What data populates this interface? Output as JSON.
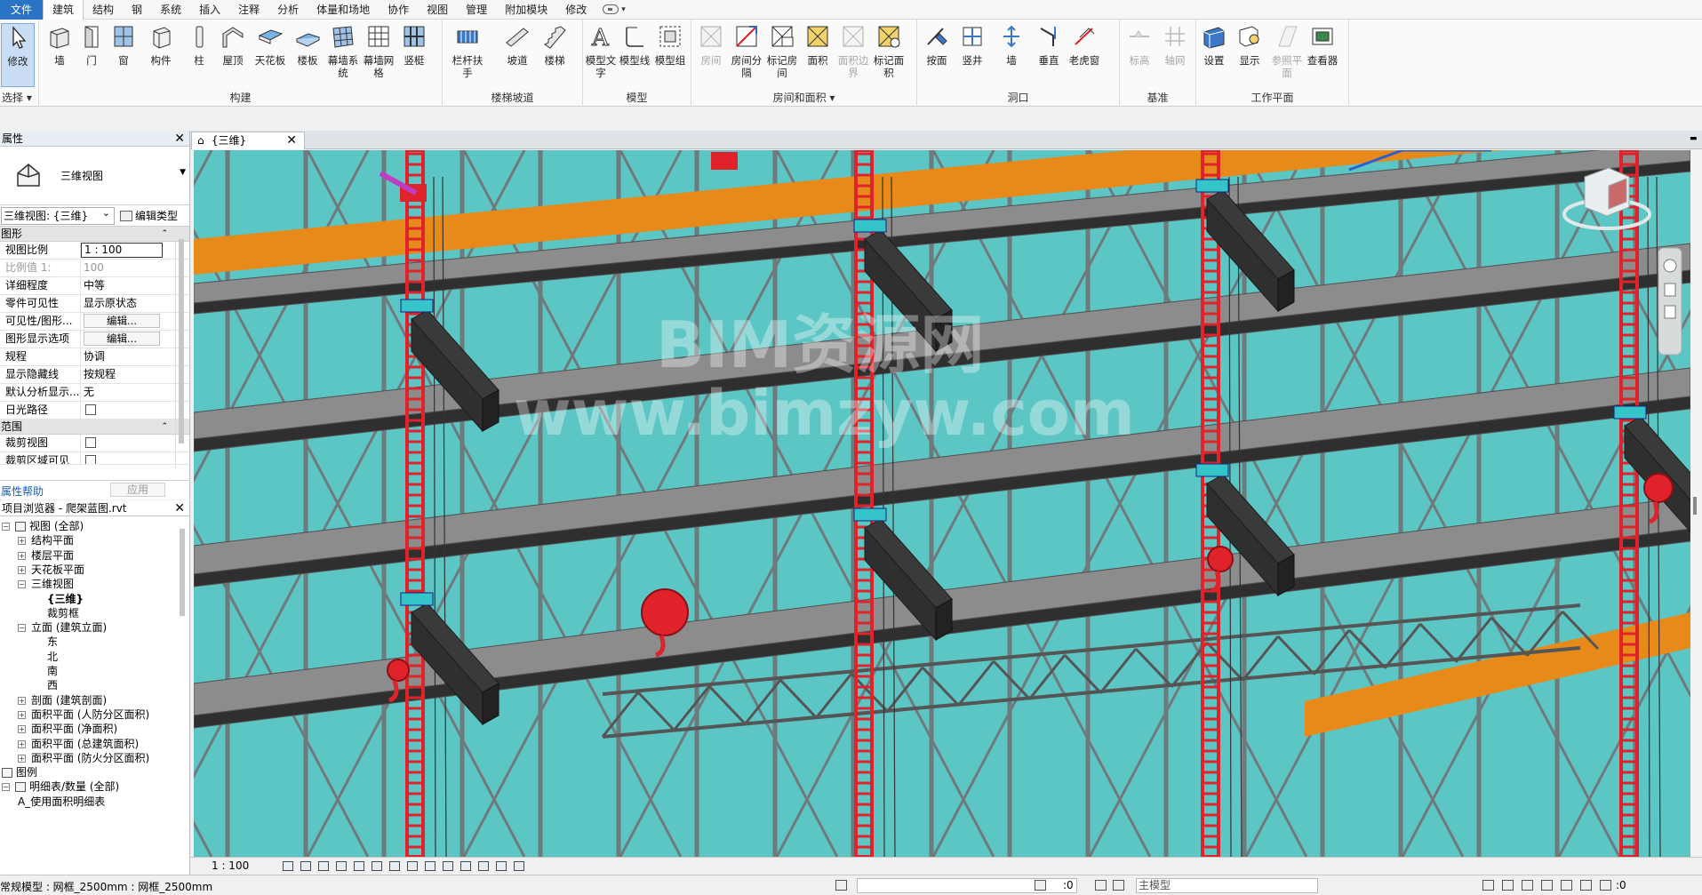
{
  "menu": {
    "file": "文件",
    "tabs": [
      "建筑",
      "结构",
      "钢",
      "系统",
      "插入",
      "注释",
      "分析",
      "体量和场地",
      "协作",
      "视图",
      "管理",
      "附加模块",
      "修改"
    ],
    "active_tab": "建筑"
  },
  "ribbon": {
    "select": {
      "modify": "修改",
      "label": "选择 ▾"
    },
    "build": {
      "label": "构建",
      "buttons": [
        "墙",
        "门",
        "窗",
        "构件",
        "柱",
        "屋顶",
        "天花板",
        "楼板",
        "幕墙系统",
        "幕墙网格",
        "竖梃"
      ]
    },
    "circulation": {
      "label": "楼梯坡道",
      "buttons": [
        "栏杆扶手",
        "坡道",
        "楼梯"
      ]
    },
    "model": {
      "label": "模型",
      "buttons": [
        "模型文字",
        "模型线",
        "模型组"
      ]
    },
    "room": {
      "label": "房间和面积 ▾",
      "buttons": [
        "房间",
        "房间分隔",
        "标记房间",
        "面积",
        "面积边界",
        "标记面积"
      ]
    },
    "opening": {
      "label": "洞口",
      "buttons": [
        "按面",
        "竖井",
        "墙",
        "垂直",
        "老虎窗"
      ]
    },
    "datum": {
      "label": "基准",
      "buttons": [
        "标高",
        "轴网"
      ]
    },
    "workplane": {
      "label": "工作平面",
      "buttons": [
        "设置",
        "显示",
        "参照平面",
        "查看器"
      ]
    }
  },
  "properties": {
    "title": "属性",
    "type_name": "三维视图",
    "selector": "三维视图: {三维}",
    "edit_type": "编辑类型",
    "sections": {
      "graphics": "图形",
      "extents": "范围"
    },
    "rows": [
      {
        "k": "视图比例",
        "v": "1 : 100"
      },
      {
        "k": "比例值 1:",
        "v": "100"
      },
      {
        "k": "详细程度",
        "v": "中等"
      },
      {
        "k": "零件可见性",
        "v": "显示原状态"
      },
      {
        "k": "可见性/图形...",
        "v": "编辑..."
      },
      {
        "k": "图形显示选项",
        "v": "编辑..."
      },
      {
        "k": "规程",
        "v": "协调"
      },
      {
        "k": "显示隐藏线",
        "v": "按规程"
      },
      {
        "k": "默认分析显示...",
        "v": "无"
      },
      {
        "k": "日光路径",
        "v": ""
      }
    ],
    "extent_rows": [
      {
        "k": "裁剪视图",
        "v": ""
      },
      {
        "k": "裁剪区域可见",
        "v": ""
      }
    ],
    "help": "属性帮助",
    "apply": "应用"
  },
  "browser": {
    "title": "项目浏览器 - 爬架蓝图.rvt",
    "nodes": [
      {
        "t": "视图 (全部)",
        "lvl": 0,
        "ex": "−"
      },
      {
        "t": "结构平面",
        "lvl": 1,
        "ex": "+"
      },
      {
        "t": "楼层平面",
        "lvl": 1,
        "ex": "+"
      },
      {
        "t": "天花板平面",
        "lvl": 1,
        "ex": "+"
      },
      {
        "t": "三维视图",
        "lvl": 1,
        "ex": "−"
      },
      {
        "t": "{三维}",
        "lvl": 2,
        "ex": ""
      },
      {
        "t": "裁剪框",
        "lvl": 2,
        "ex": ""
      },
      {
        "t": "立面 (建筑立面)",
        "lvl": 1,
        "ex": "−"
      },
      {
        "t": "东",
        "lvl": 2,
        "ex": ""
      },
      {
        "t": "北",
        "lvl": 2,
        "ex": ""
      },
      {
        "t": "南",
        "lvl": 2,
        "ex": ""
      },
      {
        "t": "西",
        "lvl": 2,
        "ex": ""
      },
      {
        "t": "剖面 (建筑剖面)",
        "lvl": 1,
        "ex": "+"
      },
      {
        "t": "面积平面 (人防分区面积)",
        "lvl": 1,
        "ex": "+"
      },
      {
        "t": "面积平面 (净面积)",
        "lvl": 1,
        "ex": "+"
      },
      {
        "t": "面积平面 (总建筑面积)",
        "lvl": 1,
        "ex": "+"
      },
      {
        "t": "面积平面 (防火分区面积)",
        "lvl": 1,
        "ex": "+"
      },
      {
        "t": "图例",
        "lvl": 0,
        "ex": ""
      },
      {
        "t": "明细表/数量 (全部)",
        "lvl": 0,
        "ex": "−"
      },
      {
        "t": "A_使用面积明细表",
        "lvl": 1,
        "ex": ""
      }
    ]
  },
  "viewport": {
    "tab": "{三维}",
    "watermark_1": "BIM资源网",
    "watermark_2": "www.bimzyw.com"
  },
  "viewbar": {
    "scale": "1 : 100"
  },
  "status": {
    "text": "常规模型 : 网框_2500mm : 网框_2500mm",
    "zero1": ":0",
    "model": "主模型",
    "zero2": ":0"
  },
  "colors": {
    "sky": "#5cc6c5",
    "ladder": "#e0232a",
    "beam": "#2f2f2f",
    "board": "#8c8c8c",
    "orange": "#e88a1a"
  }
}
